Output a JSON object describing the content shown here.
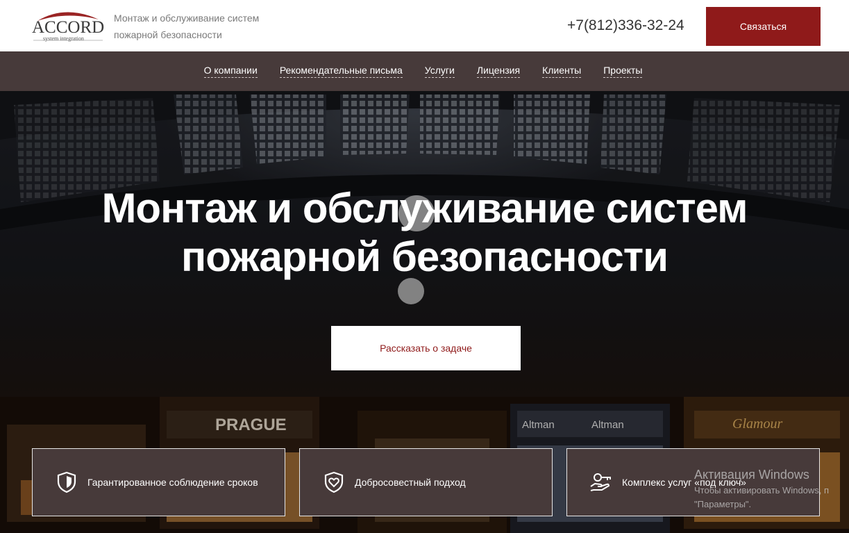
{
  "header": {
    "logo_name": "ACCORD",
    "logo_sub": "system integration",
    "tagline": "Монтаж и обслуживание систем пожарной безопасности",
    "phone": "+7(812)336-32-24",
    "contact_label": "Связаться"
  },
  "nav": {
    "items": [
      {
        "label": "О компании"
      },
      {
        "label": "Рекомендательные письма"
      },
      {
        "label": "Услуги"
      },
      {
        "label": "Лицензия"
      },
      {
        "label": "Клиенты"
      },
      {
        "label": "Проекты"
      }
    ]
  },
  "hero": {
    "title_line1": "Монтаж и обслуживание систем",
    "title_line2": "пожарной безопасности",
    "cta_label": "Рассказать о задаче",
    "background_signs": [
      "PRAGUE",
      "Altman",
      "Altman",
      "Glamour"
    ]
  },
  "features": [
    {
      "label": "Гарантированное соблюдение сроков",
      "icon": "shield-check-icon"
    },
    {
      "label": "Добросовестный подход",
      "icon": "shield-heart-icon"
    },
    {
      "label": "Комплекс услуг «под ключ»",
      "icon": "hand-key-icon"
    }
  ],
  "windows_watermark": {
    "line1": "Активация Windows",
    "line2": "Чтобы активировать Windows, п",
    "line3": "\"Параметры\"."
  },
  "colors": {
    "accent": "#8f1a1a",
    "nav_bg": "#473a3a",
    "header_bg": "#ffffff"
  }
}
